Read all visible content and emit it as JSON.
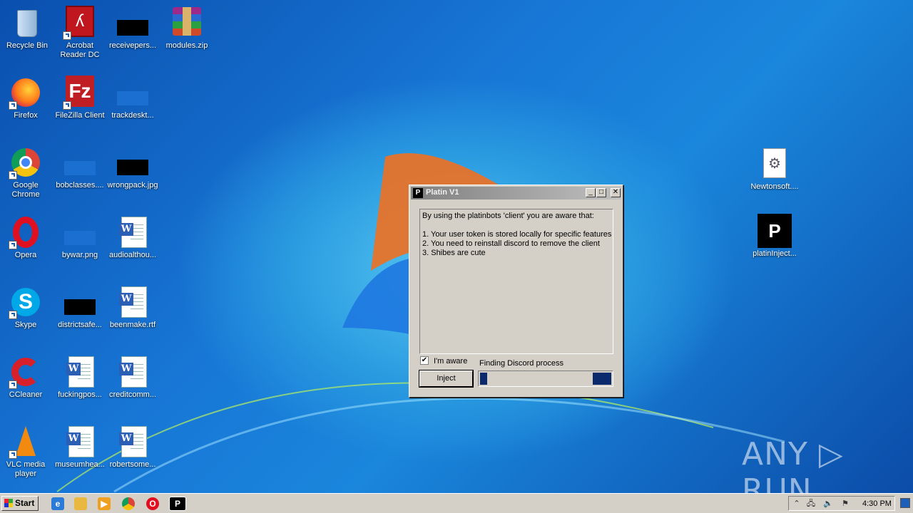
{
  "desktop": {
    "icons": [
      {
        "label": "Recycle Bin"
      },
      {
        "label": "Acrobat Reader DC"
      },
      {
        "label": "receivepers..."
      },
      {
        "label": "modules.zip"
      },
      {
        "label": "Firefox"
      },
      {
        "label": "FileZilla Client"
      },
      {
        "label": "trackdeskt..."
      },
      {
        "label": "Google Chrome"
      },
      {
        "label": "bobclasses...."
      },
      {
        "label": "wrongpack.jpg"
      },
      {
        "label": "Opera"
      },
      {
        "label": "bywar.png"
      },
      {
        "label": "audioalthou..."
      },
      {
        "label": "Skype"
      },
      {
        "label": "districtsafe..."
      },
      {
        "label": "beenmake.rtf"
      },
      {
        "label": "CCleaner"
      },
      {
        "label": "fuckingpos..."
      },
      {
        "label": "creditcomm..."
      },
      {
        "label": "VLC media player"
      },
      {
        "label": "museumhea..."
      },
      {
        "label": "robertsome..."
      },
      {
        "label": "Newtonsoft...."
      },
      {
        "label": "platinInject..."
      }
    ]
  },
  "window": {
    "title": "Platin V1",
    "title_icon": "P",
    "minimize": "_",
    "maximize": "□",
    "close": "✕",
    "text_lines": [
      "By using the platinbots 'client' you are aware that:",
      "",
      "1. Your user token is stored locally for specific features",
      "2. You need to reinstall discord to remove the client",
      "3. Shibes are cute"
    ],
    "checkbox_checked": true,
    "checkbox_label": "I'm aware",
    "status": "Finding Discord process",
    "inject_label": "Inject"
  },
  "watermark": "ANY ▷ RUN",
  "taskbar": {
    "start_label": "Start",
    "clock": "4:30 PM",
    "tray_expand": "⌃"
  },
  "colors": {
    "progress": "#0b2a6e",
    "window_face": "#d4d0c8",
    "desktop_blue": "#1877d6"
  }
}
